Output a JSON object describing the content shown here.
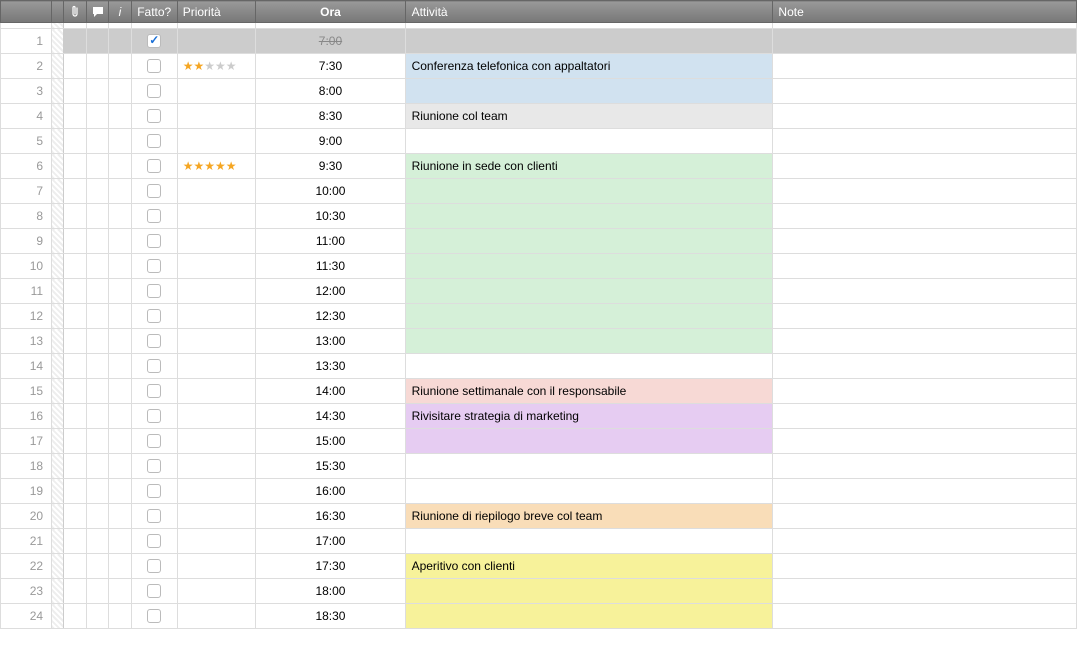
{
  "columns": {
    "done": "Fatto?",
    "priority": "Priorità",
    "time": "Ora",
    "activity": "Attività",
    "note": "Note"
  },
  "rows": [
    {
      "num": 1,
      "done": true,
      "stars": 0,
      "time": "7:00",
      "activity": "",
      "color": "done",
      "strike": true
    },
    {
      "num": 2,
      "done": false,
      "stars": 2,
      "time": "7:30",
      "activity": "Conferenza telefonica con appaltatori",
      "color": "blue"
    },
    {
      "num": 3,
      "done": false,
      "stars": 0,
      "time": "8:00",
      "activity": "",
      "color": "blue"
    },
    {
      "num": 4,
      "done": false,
      "stars": 0,
      "time": "8:30",
      "activity": "Riunione col team",
      "color": "gray"
    },
    {
      "num": 5,
      "done": false,
      "stars": 0,
      "time": "9:00",
      "activity": "",
      "color": ""
    },
    {
      "num": 6,
      "done": false,
      "stars": 5,
      "time": "9:30",
      "activity": "Riunione in sede con clienti",
      "color": "green"
    },
    {
      "num": 7,
      "done": false,
      "stars": 0,
      "time": "10:00",
      "activity": "",
      "color": "green"
    },
    {
      "num": 8,
      "done": false,
      "stars": 0,
      "time": "10:30",
      "activity": "",
      "color": "green"
    },
    {
      "num": 9,
      "done": false,
      "stars": 0,
      "time": "11:00",
      "activity": "",
      "color": "green"
    },
    {
      "num": 10,
      "done": false,
      "stars": 0,
      "time": "11:30",
      "activity": "",
      "color": "green"
    },
    {
      "num": 11,
      "done": false,
      "stars": 0,
      "time": "12:00",
      "activity": "",
      "color": "green"
    },
    {
      "num": 12,
      "done": false,
      "stars": 0,
      "time": "12:30",
      "activity": "",
      "color": "green"
    },
    {
      "num": 13,
      "done": false,
      "stars": 0,
      "time": "13:00",
      "activity": "",
      "color": "green"
    },
    {
      "num": 14,
      "done": false,
      "stars": 0,
      "time": "13:30",
      "activity": "",
      "color": ""
    },
    {
      "num": 15,
      "done": false,
      "stars": 0,
      "time": "14:00",
      "activity": "Riunione settimanale con il responsabile",
      "color": "pink"
    },
    {
      "num": 16,
      "done": false,
      "stars": 0,
      "time": "14:30",
      "activity": "Rivisitare strategia di marketing",
      "color": "purple"
    },
    {
      "num": 17,
      "done": false,
      "stars": 0,
      "time": "15:00",
      "activity": "",
      "color": "purple"
    },
    {
      "num": 18,
      "done": false,
      "stars": 0,
      "time": "15:30",
      "activity": "",
      "color": ""
    },
    {
      "num": 19,
      "done": false,
      "stars": 0,
      "time": "16:00",
      "activity": "",
      "color": ""
    },
    {
      "num": 20,
      "done": false,
      "stars": 0,
      "time": "16:30",
      "activity": "Riunione di riepilogo breve col team",
      "color": "orange"
    },
    {
      "num": 21,
      "done": false,
      "stars": 0,
      "time": "17:00",
      "activity": "",
      "color": ""
    },
    {
      "num": 22,
      "done": false,
      "stars": 0,
      "time": "17:30",
      "activity": "Aperitivo con clienti",
      "color": "yellow"
    },
    {
      "num": 23,
      "done": false,
      "stars": 0,
      "time": "18:00",
      "activity": "",
      "color": "yellow"
    },
    {
      "num": 24,
      "done": false,
      "stars": 0,
      "time": "18:30",
      "activity": "",
      "color": "yellow"
    }
  ]
}
